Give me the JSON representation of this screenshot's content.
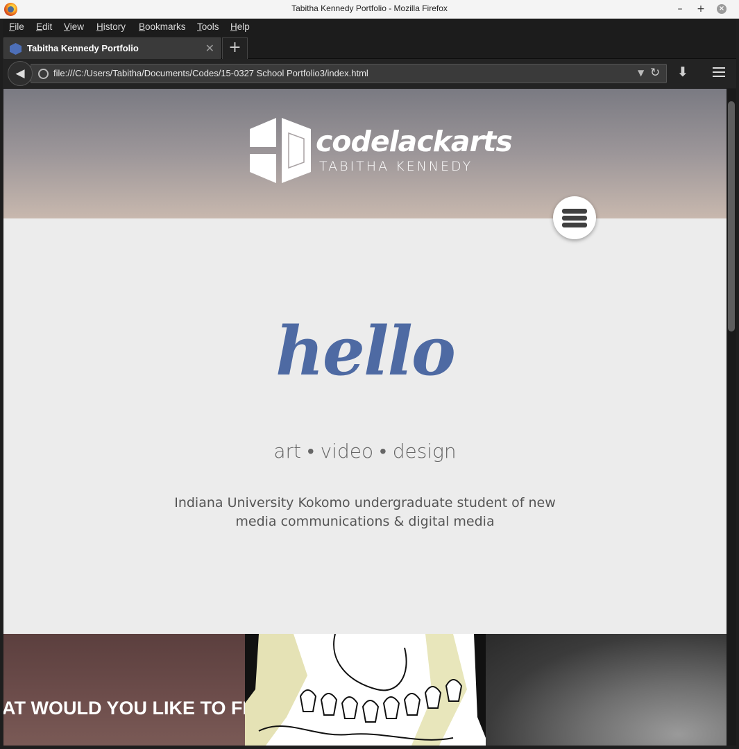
{
  "window": {
    "title": "Tabitha Kennedy Portfolio - Mozilla Firefox"
  },
  "menu": [
    "File",
    "Edit",
    "View",
    "History",
    "Bookmarks",
    "Tools",
    "Help"
  ],
  "tab": {
    "label": "Tabitha Kennedy Portfolio"
  },
  "address": {
    "url": "file:///C:/Users/Tabitha/Documents/Codes/15-0327 School Portfolio3/index.html"
  },
  "brand": {
    "name": "codelackarts",
    "subtitle": "TABITHA KENNEDY"
  },
  "hero": {
    "greeting": "hello",
    "tagline": "art • video • design",
    "description": "Indiana University Kokomo undergraduate student of new media communications & digital media"
  },
  "tiles": {
    "first_text": "AT WOULD YOU LIKE TO FI"
  },
  "icons": {
    "browser": "firefox-icon",
    "favicon": "hexagon-icon",
    "back": "back-arrow-icon",
    "reload": "reload-icon",
    "download": "download-icon",
    "menu": "hamburger-menu-icon"
  },
  "colors": {
    "accent": "#4e6aa3",
    "background": "#ececec"
  }
}
